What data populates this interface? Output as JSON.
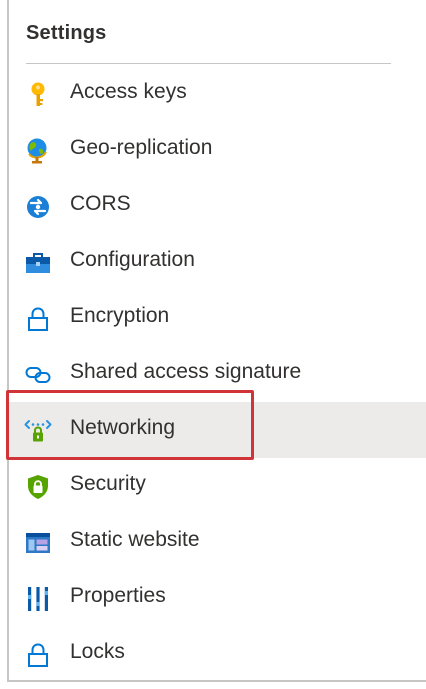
{
  "settings": {
    "header": "Settings",
    "items": [
      {
        "label": "Access keys",
        "icon": "key-icon",
        "selected": false
      },
      {
        "label": "Geo-replication",
        "icon": "globe-icon",
        "selected": false
      },
      {
        "label": "CORS",
        "icon": "cors-icon",
        "selected": false
      },
      {
        "label": "Configuration",
        "icon": "toolbox-icon",
        "selected": false
      },
      {
        "label": "Encryption",
        "icon": "lock-icon",
        "selected": false
      },
      {
        "label": "Shared access signature",
        "icon": "link-icon",
        "selected": false
      },
      {
        "label": "Networking",
        "icon": "network-lock-icon",
        "selected": true
      },
      {
        "label": "Security",
        "icon": "shield-icon",
        "selected": false
      },
      {
        "label": "Static website",
        "icon": "website-icon",
        "selected": false
      },
      {
        "label": "Properties",
        "icon": "properties-icon",
        "selected": false
      },
      {
        "label": "Locks",
        "icon": "lock-icon",
        "selected": false
      }
    ]
  },
  "colors": {
    "text": "#323130",
    "selected_background": "#edebe9",
    "highlight": "#d13438",
    "border": "#c8c6c4",
    "icon_blue": "#0078d4",
    "key_yellow": "#ffb900",
    "shield_green": "#57a300"
  }
}
